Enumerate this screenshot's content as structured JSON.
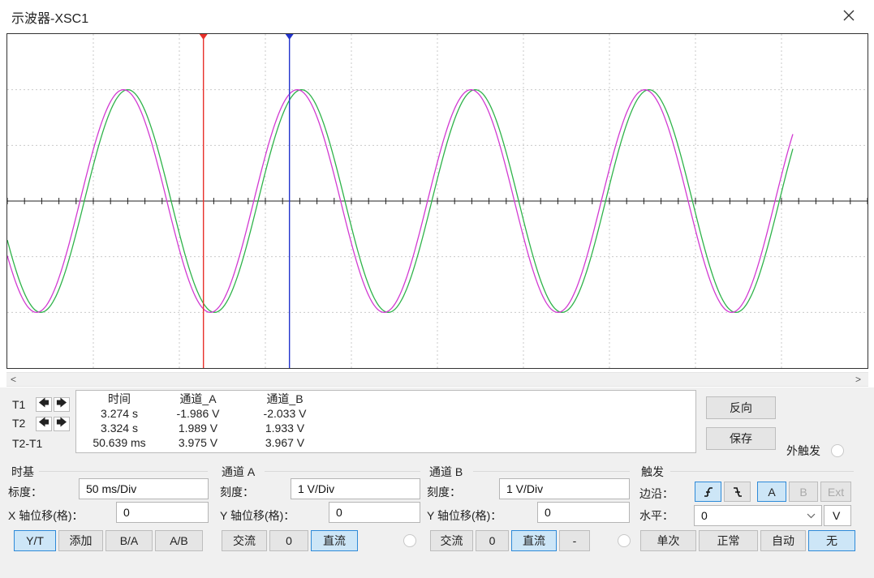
{
  "window": {
    "title": "示波器-XSC1"
  },
  "chart_data": {
    "type": "line",
    "x_divisions": 10,
    "y_divisions": 6,
    "series": [
      {
        "channel": "A",
        "color": "#2fb34a",
        "period_div": 2.02,
        "amplitude_div": 2.0,
        "phase": 0.05
      },
      {
        "channel": "B",
        "color": "#d23bd2",
        "period_div": 2.02,
        "amplitude_div": 2.0,
        "phase": 0.0
      }
    ],
    "cursors": [
      {
        "name": "T1",
        "color": "#e8302a",
        "x_div": 2.28
      },
      {
        "name": "T2",
        "color": "#2233cc",
        "x_div": 3.28
      }
    ]
  },
  "readout": {
    "headers": {
      "time": "时间",
      "cha": "通道_A",
      "chb": "通道_B"
    },
    "rows": [
      {
        "label": "T1",
        "time": "3.274 s",
        "cha": "-1.986 V",
        "chb": "-2.033 V"
      },
      {
        "label": "T2",
        "time": "3.324 s",
        "cha": "1.989 V",
        "chb": "1.933 V"
      },
      {
        "label": "T2-T1",
        "time": "50.639 ms",
        "cha": "3.975 V",
        "chb": "3.967 V"
      }
    ],
    "arrow_left": "🡄",
    "arrow_right": "🡆"
  },
  "buttons": {
    "reverse": "反向",
    "save": "保存",
    "ext_trigger": "外触发"
  },
  "timebase": {
    "title": "时基",
    "scale_label": "标度：",
    "scale_value": "50 ms/Div",
    "xpos_label": "X 轴位移(格)：",
    "xpos_value": "0",
    "modes": [
      "Y/T",
      "添加",
      "B/A",
      "A/B"
    ]
  },
  "channel_a": {
    "title": "通道 A",
    "scale_label": "刻度：",
    "scale_value": "1  V/Div",
    "ypos_label": "Y 轴位移(格)：",
    "ypos_value": "0",
    "coupling": [
      "交流",
      "0",
      "直流"
    ]
  },
  "channel_b": {
    "title": "通道 B",
    "scale_label": "刻度：",
    "scale_value": "1  V/Div",
    "ypos_label": "Y 轴位移(格)：",
    "ypos_value": "0",
    "coupling": [
      "交流",
      "0",
      "直流",
      "-"
    ]
  },
  "trigger": {
    "title": "触发",
    "edge_label": "边沿：",
    "sources": [
      "A",
      "B",
      "Ext"
    ],
    "level_label": "水平：",
    "level_value": "0",
    "level_unit": "V",
    "modes": [
      "单次",
      "正常",
      "自动",
      "无"
    ]
  }
}
